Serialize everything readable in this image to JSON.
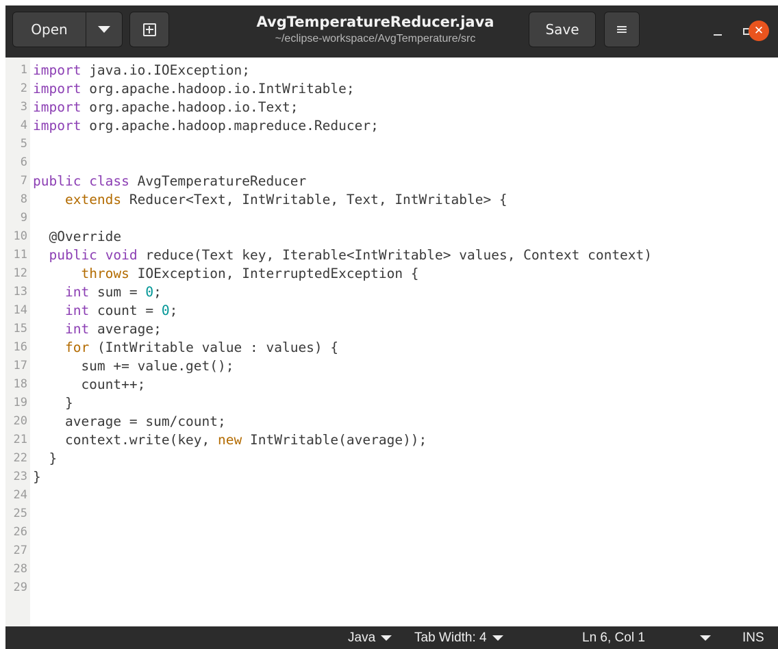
{
  "header": {
    "open_label": "Open",
    "title": "AvgTemperatureReducer.java",
    "subtitle": "~/eclipse-workspace/AvgTemperature/src",
    "save_label": "Save",
    "hamburger_glyph": "≡",
    "close_glyph": "✕",
    "icons": [
      "chevron-down-icon",
      "new-tab-icon",
      "hamburger-menu-icon",
      "minimize-icon",
      "maximize-icon",
      "close-icon"
    ]
  },
  "editor": {
    "language": "Java",
    "lines": [
      "import java.io.IOException;",
      "import org.apache.hadoop.io.IntWritable;",
      "import org.apache.hadoop.io.Text;",
      "import org.apache.hadoop.mapreduce.Reducer;",
      "",
      "",
      "public class AvgTemperatureReducer",
      "    extends Reducer<Text, IntWritable, Text, IntWritable> {",
      "",
      "  @Override",
      "  public void reduce(Text key, Iterable<IntWritable> values, Context context)",
      "      throws IOException, InterruptedException {",
      "    int sum = 0;",
      "    int count = 0;",
      "    int average;",
      "    for (IntWritable value : values) {",
      "      sum += value.get();",
      "      count++;",
      "    }",
      "    average = sum/count;",
      "    context.write(key, new IntWritable(average));",
      "  }",
      "}",
      "",
      "",
      "",
      "",
      "",
      ""
    ]
  },
  "statusbar": {
    "language": "Java",
    "tab_width": "Tab Width: 4",
    "cursor_position": "Ln 6, Col 1",
    "insert_mode": "INS"
  },
  "colors": {
    "headerbar": "#2c2c2c",
    "keyword": "#8c3fb4",
    "keyword_orange": "#b36b00",
    "number": "#009696",
    "close_button": "#e9541e"
  }
}
